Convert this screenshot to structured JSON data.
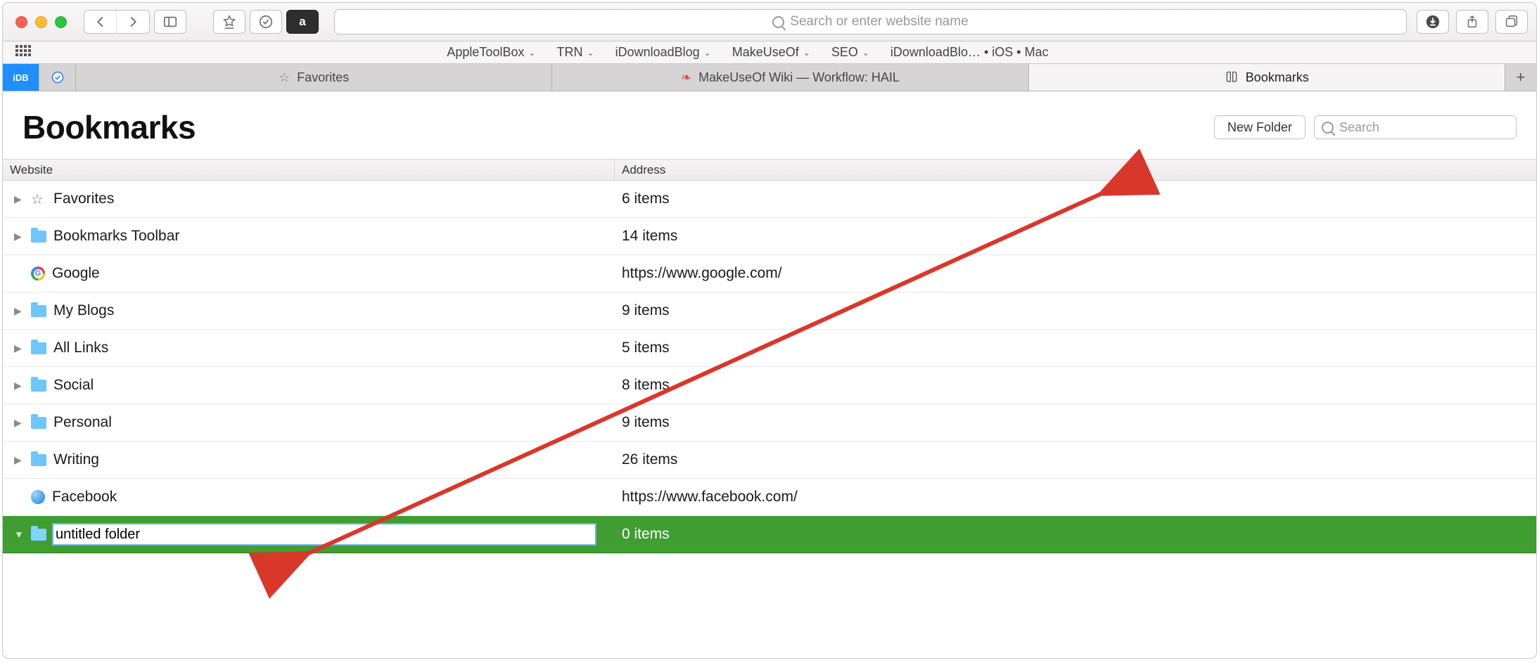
{
  "toolbar": {
    "address_placeholder": "Search or enter website name"
  },
  "favbar": {
    "items": [
      {
        "label": "AppleToolBox",
        "dropdown": true
      },
      {
        "label": "TRN",
        "dropdown": true
      },
      {
        "label": "iDownloadBlog",
        "dropdown": true
      },
      {
        "label": "MakeUseOf",
        "dropdown": true
      },
      {
        "label": "SEO",
        "dropdown": true
      },
      {
        "label": "iDownloadBlo… • iOS • Mac",
        "dropdown": false
      }
    ]
  },
  "tabs": {
    "pin_idb": "iDB",
    "items": [
      {
        "label": "Favorites",
        "active": false,
        "icon": "star"
      },
      {
        "label": "MakeUseOf Wiki — Workflow: HAIL",
        "active": false,
        "icon": "leaf"
      },
      {
        "label": "Bookmarks",
        "active": true,
        "icon": "book"
      }
    ]
  },
  "content": {
    "title": "Bookmarks",
    "new_folder_label": "New Folder",
    "search_placeholder": "Search"
  },
  "table": {
    "col_website": "Website",
    "col_address": "Address",
    "rows": [
      {
        "type": "folder",
        "icon": "star",
        "name": "Favorites",
        "addr": "6 items",
        "disclosure": true
      },
      {
        "type": "folder",
        "icon": "folder",
        "name": "Bookmarks Toolbar",
        "addr": "14 items",
        "disclosure": true
      },
      {
        "type": "link",
        "icon": "google",
        "name": "Google",
        "addr": "https://www.google.com/",
        "disclosure": false
      },
      {
        "type": "folder",
        "icon": "folder",
        "name": "My Blogs",
        "addr": "9 items",
        "disclosure": true
      },
      {
        "type": "folder",
        "icon": "folder",
        "name": "All Links",
        "addr": "5 items",
        "disclosure": true
      },
      {
        "type": "folder",
        "icon": "folder",
        "name": "Social",
        "addr": "8 items",
        "disclosure": true
      },
      {
        "type": "folder",
        "icon": "folder",
        "name": "Personal",
        "addr": "9 items",
        "disclosure": true
      },
      {
        "type": "folder",
        "icon": "folder",
        "name": "Writing",
        "addr": "26 items",
        "disclosure": true
      },
      {
        "type": "link",
        "icon": "globe",
        "name": "Facebook",
        "addr": "https://www.facebook.com/",
        "disclosure": false
      }
    ],
    "selected_row": {
      "name": "untitled folder",
      "addr": "0 items"
    }
  }
}
